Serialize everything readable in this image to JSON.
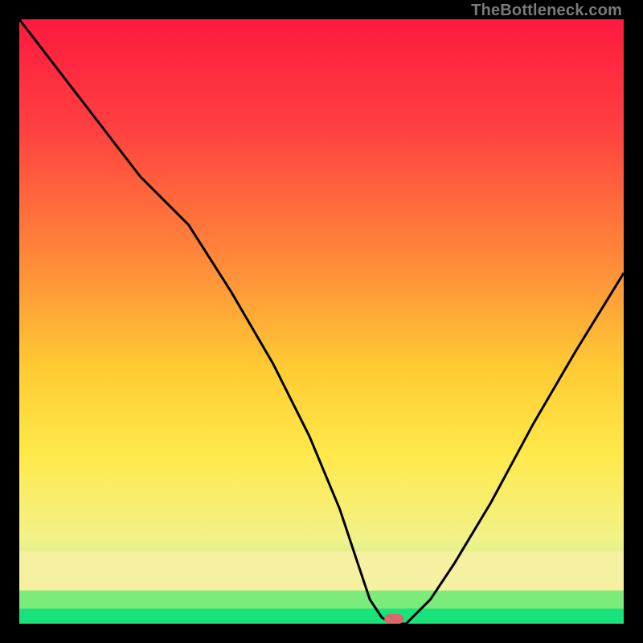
{
  "watermark": "TheBottleneck.com",
  "chart_data": {
    "type": "line",
    "title": "",
    "xlabel": "",
    "ylabel": "",
    "xlim": [
      0,
      100
    ],
    "ylim": [
      0,
      100
    ],
    "series": [
      {
        "name": "bottleneck-curve",
        "x": [
          0,
          10,
          20,
          28,
          35,
          42,
          48,
          53,
          56,
          58,
          60,
          62,
          64,
          68,
          72,
          78,
          85,
          92,
          100
        ],
        "y": [
          100,
          87,
          74,
          66,
          55,
          43,
          31,
          19,
          10,
          4,
          1,
          0,
          0,
          4,
          10,
          20,
          33,
          45,
          58
        ]
      }
    ],
    "threshold_zones": [
      {
        "name": "green",
        "y0": 0,
        "y1": 2.5,
        "color": "#19e27b"
      },
      {
        "name": "light-green",
        "y0": 2.5,
        "y1": 5.5,
        "color": "#7beb7a"
      },
      {
        "name": "pale-yellow",
        "y0": 5.5,
        "y1": 12,
        "color": "#f5f1a0"
      }
    ],
    "marker": {
      "name": "optimal-point",
      "x": 62,
      "y": 0.8,
      "color": "#d66a6a"
    },
    "gradient_stops": [
      {
        "offset": 0,
        "color": "#ff1a3e"
      },
      {
        "offset": 0.18,
        "color": "#ff4040"
      },
      {
        "offset": 0.4,
        "color": "#ff8a3a"
      },
      {
        "offset": 0.58,
        "color": "#ffcc33"
      },
      {
        "offset": 0.72,
        "color": "#ffe94a"
      },
      {
        "offset": 0.86,
        "color": "#f2f28a"
      },
      {
        "offset": 0.93,
        "color": "#b8eb87"
      },
      {
        "offset": 0.975,
        "color": "#64e27e"
      },
      {
        "offset": 1.0,
        "color": "#16df78"
      }
    ]
  }
}
